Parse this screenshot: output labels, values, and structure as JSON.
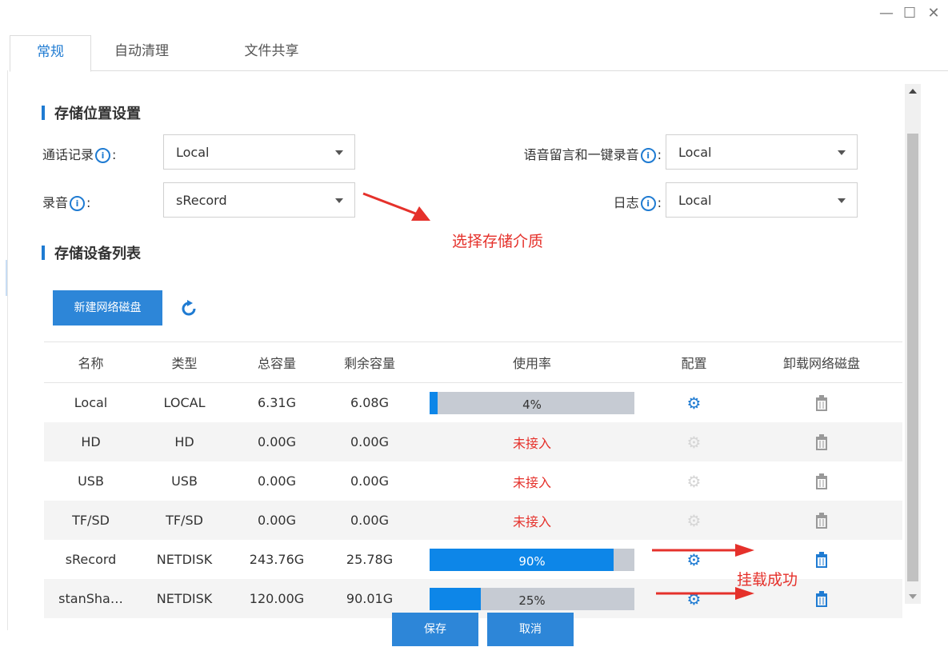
{
  "window_controls": {
    "minimize": "—",
    "maximize": "☐",
    "close": "✕"
  },
  "tabs": [
    {
      "label": "常规",
      "active": true
    },
    {
      "label": "自动清理",
      "active": false
    },
    {
      "label": "文件共享",
      "active": false
    }
  ],
  "storage_location": {
    "title": "存储位置设置",
    "call_records": {
      "label": "通话记录",
      "value": "Local"
    },
    "recording": {
      "label": "录音",
      "value": "sRecord"
    },
    "voicemail": {
      "label": "语音留言和一键录音",
      "value": "Local"
    },
    "log": {
      "label": "日志",
      "value": "Local"
    },
    "info_icon": "ⓘ",
    "colon": ":"
  },
  "annotations": {
    "select_medium": "选择存储介质",
    "mount_success": "挂载成功"
  },
  "device_list": {
    "title": "存储设备列表",
    "new_disk_button": "新建网络磁盘",
    "refresh_icon": "refresh-icon",
    "columns": [
      "名称",
      "类型",
      "总容量",
      "剩余容量",
      "使用率",
      "配置",
      "卸载网络磁盘"
    ],
    "rows": [
      {
        "name": "Local",
        "type": "LOCAL",
        "total": "6.31G",
        "free": "6.08G",
        "usage_text": "4%",
        "usage": 0.04,
        "connected": true
      },
      {
        "name": "HD",
        "type": "HD",
        "total": "0.00G",
        "free": "0.00G",
        "usage_text": "未接入",
        "usage": null,
        "connected": false
      },
      {
        "name": "USB",
        "type": "USB",
        "total": "0.00G",
        "free": "0.00G",
        "usage_text": "未接入",
        "usage": null,
        "connected": false
      },
      {
        "name": "TF/SD",
        "type": "TF/SD",
        "total": "0.00G",
        "free": "0.00G",
        "usage_text": "未接入",
        "usage": null,
        "connected": false
      },
      {
        "name": "sRecord",
        "type": "NETDISK",
        "total": "243.76G",
        "free": "25.78G",
        "usage_text": "90%",
        "usage": 0.9,
        "connected": true
      },
      {
        "name": "stanSha…",
        "type": "NETDISK",
        "total": "120.00G",
        "free": "90.01G",
        "usage_text": "25%",
        "usage": 0.25,
        "connected": true
      }
    ]
  },
  "footer": {
    "save": "保存",
    "cancel": "取消"
  },
  "colors": {
    "accent": "#1f7bd2",
    "progress_fill": "#0d86e8",
    "progress_bg": "#c6cbd3",
    "annotation_red": "#e5312b"
  }
}
